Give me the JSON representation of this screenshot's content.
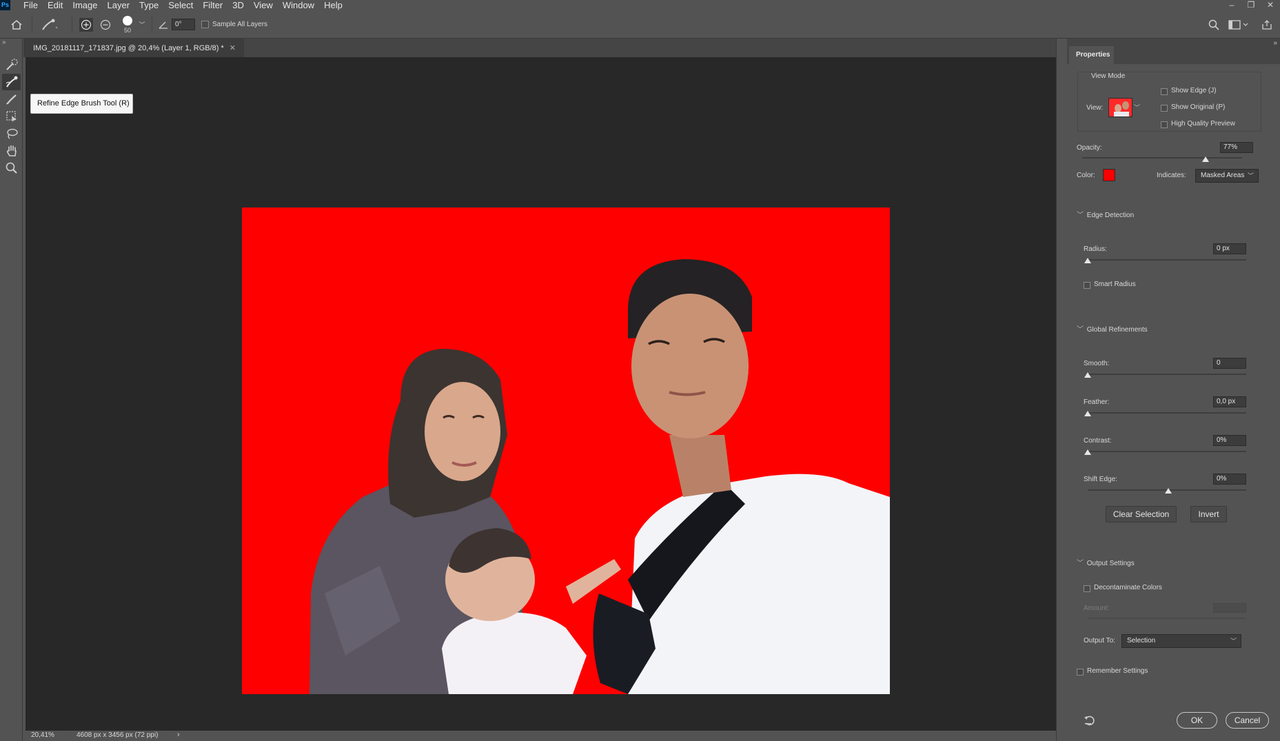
{
  "app": {
    "logo": "Ps"
  },
  "menubar": {
    "items": [
      "File",
      "Edit",
      "Image",
      "Layer",
      "Type",
      "Select",
      "Filter",
      "3D",
      "View",
      "Window",
      "Help"
    ]
  },
  "window_controls": {
    "minimize": "–",
    "restore": "❐",
    "close": "✕"
  },
  "options": {
    "brush_size": "50",
    "angle": "0°",
    "sample_all_layers": "Sample All Layers",
    "sample_all_layers_checked": false
  },
  "toolbar": {
    "tools": [
      "quick-selection",
      "refine-edge-brush",
      "brush",
      "object-selection",
      "lasso",
      "hand",
      "zoom"
    ],
    "active": "refine-edge-brush"
  },
  "tooltip": "Refine Edge Brush Tool (R)",
  "document": {
    "tab_title": "IMG_20181117_171837.jpg @ 20,4% (Layer 1, RGB/8) *",
    "overlay_color": "#ff0000"
  },
  "status": {
    "zoom": "20,41%",
    "dimensions": "4608 px x 3456 px (72 ppi)",
    "arrow": "›"
  },
  "properties": {
    "tab": "Properties",
    "view_mode": {
      "title": "View Mode",
      "view_label": "View:",
      "show_edge": "Show Edge (J)",
      "show_original": "Show Original (P)",
      "high_quality": "High Quality Preview"
    },
    "opacity": {
      "label": "Opacity:",
      "value": "77%",
      "level": 0.77
    },
    "color": {
      "label": "Color:",
      "swatch": "#ff0000",
      "indicates_label": "Indicates:",
      "indicates_value": "Masked Areas"
    },
    "edge_detection": {
      "title": "Edge Detection",
      "radius_label": "Radius:",
      "radius_value": "0 px",
      "smart_radius": "Smart Radius"
    },
    "global_refinements": {
      "title": "Global Refinements",
      "smooth_label": "Smooth:",
      "smooth_value": "0",
      "feather_label": "Feather:",
      "feather_value": "0,0 px",
      "contrast_label": "Contrast:",
      "contrast_value": "0%",
      "shift_edge_label": "Shift Edge:",
      "shift_edge_value": "0%",
      "clear_selection": "Clear Selection",
      "invert": "Invert"
    },
    "output_settings": {
      "title": "Output Settings",
      "decontaminate": "Decontaminate Colors",
      "amount_label": "Amount:",
      "output_to_label": "Output To:",
      "output_to_value": "Selection",
      "remember": "Remember Settings"
    },
    "ok": "OK",
    "cancel": "Cancel"
  }
}
